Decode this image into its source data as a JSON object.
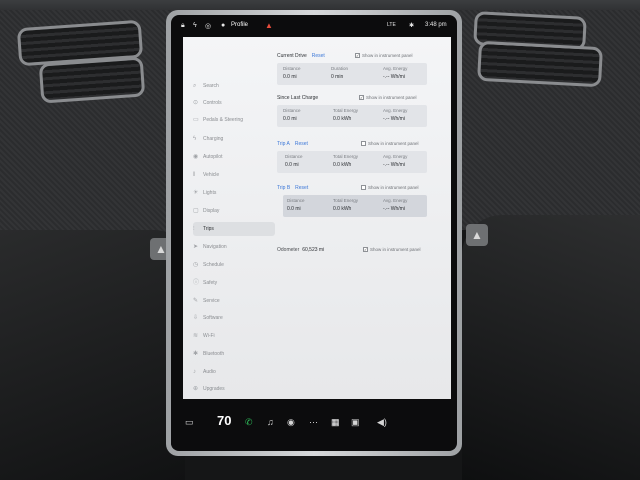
{
  "status_bar": {
    "profile_label": "Profile",
    "lte_label": "LTE",
    "time": "3:48 pm",
    "icons": [
      "lock-icon",
      "lightning-icon",
      "tpms-icon",
      "person-icon",
      "warning-icon",
      "signal-icon",
      "bluetooth-icon"
    ]
  },
  "sidebar": {
    "items": [
      {
        "label": "Search",
        "icon": "search-icon"
      },
      {
        "label": "Controls",
        "icon": "controls-icon"
      },
      {
        "label": "Pedals & Steering",
        "icon": "car-icon"
      },
      {
        "label": "Charging",
        "icon": "lightning-icon"
      },
      {
        "label": "Autopilot",
        "icon": "steering-wheel-icon"
      },
      {
        "label": "Vehicle",
        "icon": "vehicle-icon"
      },
      {
        "label": "Lights",
        "icon": "light-bulb-icon"
      },
      {
        "label": "Display",
        "icon": "display-icon"
      },
      {
        "label": "Trips",
        "icon": "trips-icon"
      },
      {
        "label": "Navigation",
        "icon": "navigation-icon"
      },
      {
        "label": "Schedule",
        "icon": "clock-icon"
      },
      {
        "label": "Safety",
        "icon": "safety-icon"
      },
      {
        "label": "Service",
        "icon": "wrench-icon"
      },
      {
        "label": "Software",
        "icon": "download-icon"
      },
      {
        "label": "Wi-Fi",
        "icon": "wifi-icon"
      },
      {
        "label": "Bluetooth",
        "icon": "bluetooth-icon"
      },
      {
        "label": "Audio",
        "icon": "audio-icon"
      },
      {
        "label": "Upgrades",
        "icon": "upgrades-icon"
      }
    ],
    "active": "Trips"
  },
  "trips": {
    "show_label": "Show in instrument panel",
    "reset_label": "Reset",
    "current_drive": {
      "title": "Current Drive",
      "distance_label": "Distance",
      "distance_value": "0.0 mi",
      "duration_label": "Duration",
      "duration_value": "0 min",
      "avg_label": "Avg. Energy",
      "avg_value": "-.-- Wh/mi",
      "checked": true
    },
    "since_last_charge": {
      "title": "Since Last Charge",
      "distance_label": "Distance",
      "distance_value": "0.0 mi",
      "energy_label": "Total Energy",
      "energy_value": "0.0 kWh",
      "avg_label": "Avg. Energy",
      "avg_value": "-.-- Wh/mi",
      "checked": true
    },
    "trip_a": {
      "title": "Trip A",
      "distance_label": "Distance",
      "distance_value": "0.0 mi",
      "energy_label": "Total Energy",
      "energy_value": "0.0 kWh",
      "avg_label": "Avg. Energy",
      "avg_value": "-.-- Wh/mi",
      "checked": false
    },
    "trip_b": {
      "title": "Trip B",
      "distance_label": "Distance",
      "distance_value": "0.0 mi",
      "energy_label": "Total Energy",
      "energy_value": "0.0 kWh",
      "avg_label": "Avg. Energy",
      "avg_value": "-.-- Wh/mi",
      "checked": false
    },
    "odometer_label": "Odometer",
    "odometer_value": "60,523 mi",
    "odometer_checked": true
  },
  "dock": {
    "temperature": "70",
    "icons": [
      "car-icon",
      "phone-icon",
      "music-icon",
      "media-icon",
      "more-icon",
      "calendar-icon",
      "apps-icon",
      "volume-icon"
    ]
  },
  "colors": {
    "accent": "#3d78d8",
    "alert": "#e74c3c",
    "phone": "#2fbf5b"
  }
}
